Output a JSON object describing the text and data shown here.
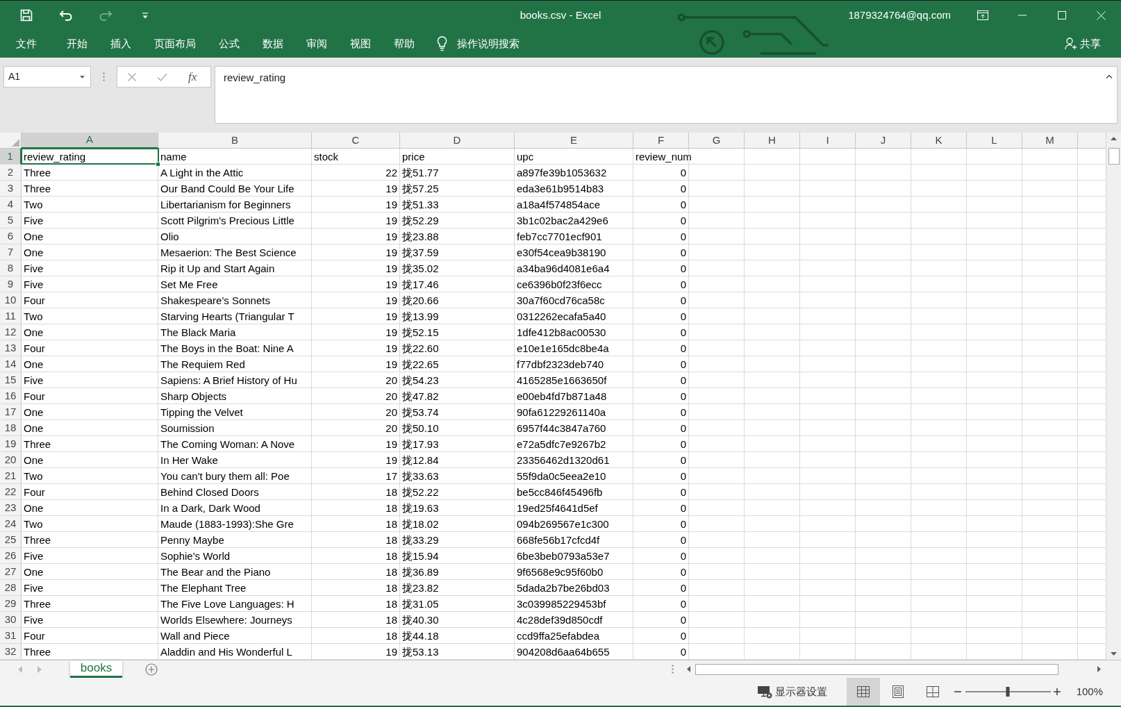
{
  "window": {
    "title": "books.csv - Excel",
    "account": "1879324764@qq.com"
  },
  "quick_access": [
    {
      "kind": "save",
      "disabled": false
    },
    {
      "kind": "undo",
      "disabled": false
    },
    {
      "kind": "redo",
      "disabled": true
    },
    {
      "kind": "customize",
      "disabled": false
    }
  ],
  "ribbon": {
    "tabs": [
      {
        "label": "文件"
      },
      {
        "label": "开始"
      },
      {
        "label": "插入"
      },
      {
        "label": "页面布局"
      },
      {
        "label": "公式"
      },
      {
        "label": "数据"
      },
      {
        "label": "审阅"
      },
      {
        "label": "视图"
      },
      {
        "label": "帮助"
      }
    ],
    "search": "操作说明搜索",
    "share": "共享"
  },
  "formula_bar": {
    "name_box": "A1",
    "function_label": "fx",
    "value": "review_rating"
  },
  "sheet": {
    "columns": [
      {
        "letter": "A",
        "selected": true
      },
      {
        "letter": "B",
        "selected": false
      },
      {
        "letter": "C",
        "selected": false
      },
      {
        "letter": "D",
        "selected": false
      },
      {
        "letter": "E",
        "selected": false
      },
      {
        "letter": "F",
        "selected": false
      },
      {
        "letter": "G",
        "selected": false
      },
      {
        "letter": "H",
        "selected": false
      },
      {
        "letter": "I",
        "selected": false
      },
      {
        "letter": "J",
        "selected": false
      },
      {
        "letter": "K",
        "selected": false
      },
      {
        "letter": "L",
        "selected": false
      },
      {
        "letter": "M",
        "selected": false
      }
    ],
    "header_row": {
      "number": "1",
      "selected": true,
      "fields": [
        {
          "name": "review_rating",
          "kind": "text"
        },
        {
          "name": "name",
          "kind": "text"
        },
        {
          "name": "stock",
          "kind": "number"
        },
        {
          "name": "price",
          "kind": "text"
        },
        {
          "name": "upc",
          "kind": "text"
        },
        {
          "name": "review_num",
          "kind": "number"
        }
      ]
    },
    "rows": [
      {
        "number": "2",
        "selected": false,
        "cells": [
          "Three",
          "A Light in the Attic",
          "22",
          "拢51.77",
          "a897fe39b1053632",
          "0"
        ]
      },
      {
        "number": "3",
        "selected": false,
        "cells": [
          "Three",
          "Our Band Could Be Your Life",
          "19",
          "拢57.25",
          "eda3e61b9514b83",
          "0"
        ]
      },
      {
        "number": "4",
        "selected": false,
        "cells": [
          "Two",
          "Libertarianism for Beginners",
          "19",
          "拢51.33",
          "a18a4f574854ace",
          "0"
        ]
      },
      {
        "number": "5",
        "selected": false,
        "cells": [
          "Five",
          "Scott Pilgrim's Precious Little",
          "19",
          "拢52.29",
          "3b1c02bac2a429e6",
          "0"
        ]
      },
      {
        "number": "6",
        "selected": false,
        "cells": [
          "One",
          "Olio",
          "19",
          "拢23.88",
          "feb7cc7701ecf901",
          "0"
        ]
      },
      {
        "number": "7",
        "selected": false,
        "cells": [
          "One",
          "Mesaerion: The Best Science",
          "19",
          "拢37.59",
          "e30f54cea9b38190",
          "0"
        ]
      },
      {
        "number": "8",
        "selected": false,
        "cells": [
          "Five",
          "Rip it Up and Start Again",
          "19",
          "拢35.02",
          "a34ba96d4081e6a4",
          "0"
        ]
      },
      {
        "number": "9",
        "selected": false,
        "cells": [
          "Five",
          "Set Me Free",
          "19",
          "拢17.46",
          "ce6396b0f23f6ecc",
          "0"
        ]
      },
      {
        "number": "10",
        "selected": false,
        "cells": [
          "Four",
          "Shakespeare's Sonnets",
          "19",
          "拢20.66",
          "30a7f60cd76ca58c",
          "0"
        ]
      },
      {
        "number": "11",
        "selected": false,
        "cells": [
          "Two",
          "Starving Hearts (Triangular T",
          "19",
          "拢13.99",
          "0312262ecafa5a40",
          "0"
        ]
      },
      {
        "number": "12",
        "selected": false,
        "cells": [
          "One",
          "The Black Maria",
          "19",
          "拢52.15",
          "1dfe412b8ac00530",
          "0"
        ]
      },
      {
        "number": "13",
        "selected": false,
        "cells": [
          "Four",
          "The Boys in the Boat: Nine A",
          "19",
          "拢22.60",
          "e10e1e165dc8be4a",
          "0"
        ]
      },
      {
        "number": "14",
        "selected": false,
        "cells": [
          "One",
          "The Requiem Red",
          "19",
          "拢22.65",
          "f77dbf2323deb740",
          "0"
        ]
      },
      {
        "number": "15",
        "selected": false,
        "cells": [
          "Five",
          "Sapiens: A Brief History of Hu",
          "20",
          "拢54.23",
          "4165285e1663650f",
          "0"
        ]
      },
      {
        "number": "16",
        "selected": false,
        "cells": [
          "Four",
          "Sharp Objects",
          "20",
          "拢47.82",
          "e00eb4fd7b871a48",
          "0"
        ]
      },
      {
        "number": "17",
        "selected": false,
        "cells": [
          "One",
          "Tipping the Velvet",
          "20",
          "拢53.74",
          "90fa61229261140a",
          "0"
        ]
      },
      {
        "number": "18",
        "selected": false,
        "cells": [
          "One",
          "Soumission",
          "20",
          "拢50.10",
          "6957f44c3847a760",
          "0"
        ]
      },
      {
        "number": "19",
        "selected": false,
        "cells": [
          "Three",
          "The Coming Woman: A Nove",
          "19",
          "拢17.93",
          "e72a5dfc7e9267b2",
          "0"
        ]
      },
      {
        "number": "20",
        "selected": false,
        "cells": [
          "One",
          "In Her Wake",
          "19",
          "拢12.84",
          "23356462d1320d61",
          "0"
        ]
      },
      {
        "number": "21",
        "selected": false,
        "cells": [
          "Two",
          "You can't bury them all: Poe",
          "17",
          "拢33.63",
          "55f9da0c5eea2e10",
          "0"
        ]
      },
      {
        "number": "22",
        "selected": false,
        "cells": [
          "Four",
          "Behind Closed Doors",
          "18",
          "拢52.22",
          "be5cc846f45496fb",
          "0"
        ]
      },
      {
        "number": "23",
        "selected": false,
        "cells": [
          "One",
          "In a Dark, Dark Wood",
          "18",
          "拢19.63",
          "19ed25f4641d5ef",
          "0"
        ]
      },
      {
        "number": "24",
        "selected": false,
        "cells": [
          "Two",
          "Maude (1883-1993):She Gre",
          "18",
          "拢18.02",
          "094b269567e1c300",
          "0"
        ]
      },
      {
        "number": "25",
        "selected": false,
        "cells": [
          "Three",
          "Penny Maybe",
          "18",
          "拢33.29",
          "668fe56b17cfcd4f",
          "0"
        ]
      },
      {
        "number": "26",
        "selected": false,
        "cells": [
          "Five",
          "Sophie's World",
          "18",
          "拢15.94",
          "6be3beb0793a53e7",
          "0"
        ]
      },
      {
        "number": "27",
        "selected": false,
        "cells": [
          "One",
          "The Bear and the Piano",
          "18",
          "拢36.89",
          "9f6568e9c95f60b0",
          "0"
        ]
      },
      {
        "number": "28",
        "selected": false,
        "cells": [
          "Five",
          "The Elephant Tree",
          "18",
          "拢23.82",
          "5dada2b7be26bd03",
          "0"
        ]
      },
      {
        "number": "29",
        "selected": false,
        "cells": [
          "Three",
          "The Five Love Languages: H",
          "18",
          "拢31.05",
          "3c039985229453bf",
          "0"
        ]
      },
      {
        "number": "30",
        "selected": false,
        "cells": [
          "Five",
          "Worlds Elsewhere: Journeys",
          "18",
          "拢40.30",
          "4c28def39d850cdf",
          "0"
        ]
      },
      {
        "number": "31",
        "selected": false,
        "cells": [
          "Four",
          "Wall and Piece",
          "18",
          "拢44.18",
          "ccd9ffa25efabdea",
          "0"
        ]
      },
      {
        "number": "32",
        "selected": false,
        "cells": [
          "Three",
          "Aladdin and His Wonderful L",
          "19",
          "拢53.13",
          "904208d6aa64b655",
          "0"
        ]
      }
    ]
  },
  "sheet_tabs": [
    {
      "label": "books",
      "selected": true
    }
  ],
  "status_bar": {
    "display_settings": "显示器设置",
    "views": [
      {
        "kind": "normal",
        "selected": true
      },
      {
        "kind": "page_layout",
        "selected": false
      },
      {
        "kind": "page_break_preview",
        "selected": false
      }
    ],
    "zoom": {
      "level": 0.5,
      "label": "100%"
    }
  }
}
